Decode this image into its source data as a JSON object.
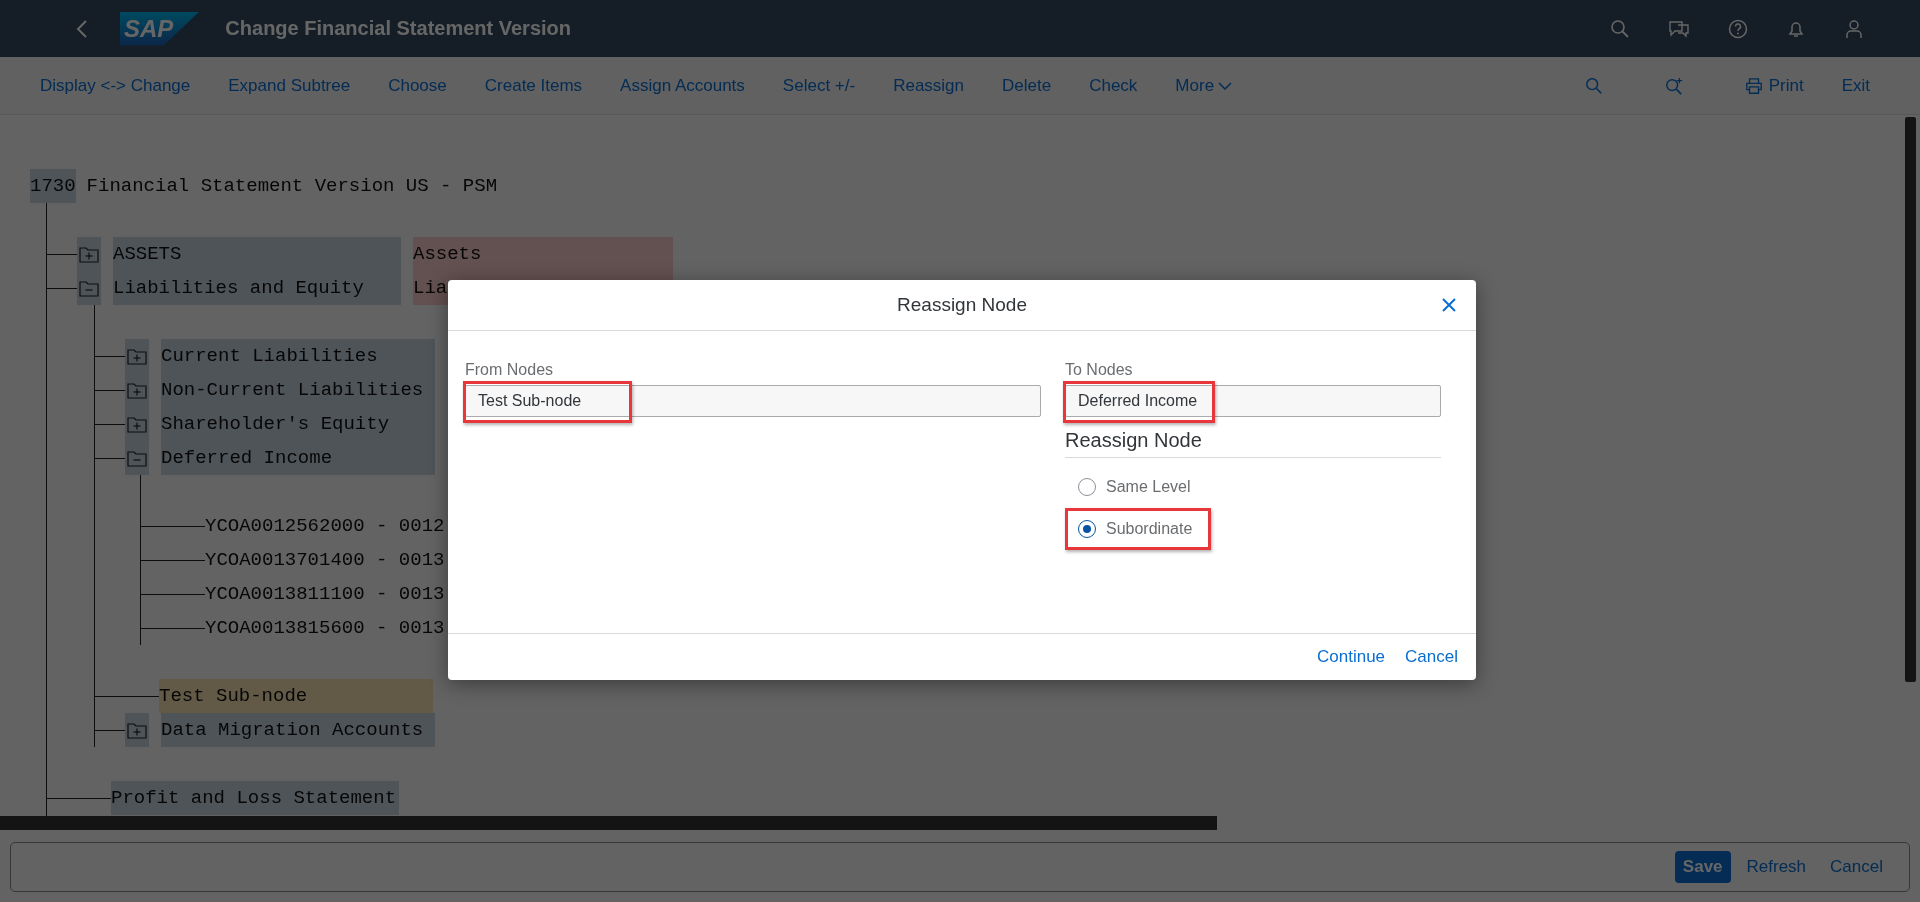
{
  "shell": {
    "title": "Change Financial Statement Version",
    "logo": "SAP"
  },
  "toolbar": {
    "items": [
      "Display <-> Change",
      "Expand Subtree",
      "Choose",
      "Create Items",
      "Assign Accounts",
      "Select +/-",
      "Reassign",
      "Delete",
      "Check"
    ],
    "more": "More",
    "right": [
      {
        "kind": "search"
      },
      {
        "kind": "zoom"
      },
      {
        "kind": "print",
        "label": "Print"
      },
      {
        "kind": "text",
        "label": "Exit"
      }
    ]
  },
  "tree": {
    "root": {
      "code": "1730",
      "label": "Financial Statement Version US - PSM"
    },
    "children": [
      {
        "label": "ASSETS",
        "kind": "folder",
        "expanded": false,
        "selected": false,
        "description": "Assets"
      },
      {
        "label": "Liabilities and Equity",
        "kind": "folder",
        "expanded": true,
        "selected": false,
        "description": "Lia",
        "children": [
          {
            "label": "Current Liabilities",
            "kind": "folder",
            "expanded": false,
            "selected": false
          },
          {
            "label": "Non-Current Liabilities",
            "kind": "folder",
            "expanded": false,
            "selected": false
          },
          {
            "label": "Shareholder's Equity",
            "kind": "folder",
            "expanded": false,
            "selected": false
          },
          {
            "label": "Deferred Income",
            "kind": "folder",
            "expanded": true,
            "selected": false,
            "children": [
              {
                "label": "YCOA0012562000 - 0012",
                "kind": "account",
                "selected": false
              },
              {
                "label": "YCOA0013701400 - 0013",
                "kind": "account",
                "selected": false
              },
              {
                "label": "YCOA0013811100 - 0013",
                "kind": "account",
                "selected": false
              },
              {
                "label": "YCOA0013815600 - 0013",
                "kind": "account",
                "selected": false
              }
            ]
          },
          {
            "label": "Test Sub-node",
            "kind": "leaf",
            "selected": true
          },
          {
            "label": "Data Migration Accounts",
            "kind": "folder",
            "expanded": false,
            "selected": false
          }
        ]
      },
      {
        "label": "Profit and Loss Statement",
        "kind": "leaf",
        "selected": false
      }
    ]
  },
  "dialog": {
    "title": "Reassign Node",
    "from": {
      "label": "From Nodes",
      "value": "Test Sub-node",
      "highlighted": true
    },
    "to": {
      "label": "To Nodes",
      "value": "Deferred Income",
      "highlighted": true
    },
    "group_title": "Reassign Node",
    "options": [
      {
        "label": "Same Level",
        "selected": false
      },
      {
        "label": "Subordinate",
        "selected": true,
        "highlighted": true
      }
    ],
    "buttons": [
      "Continue",
      "Cancel"
    ]
  },
  "footer": {
    "buttons": [
      {
        "label": "Save",
        "kind": "primary"
      },
      {
        "label": "Refresh",
        "kind": "plain"
      },
      {
        "label": "Cancel",
        "kind": "plain"
      }
    ]
  }
}
